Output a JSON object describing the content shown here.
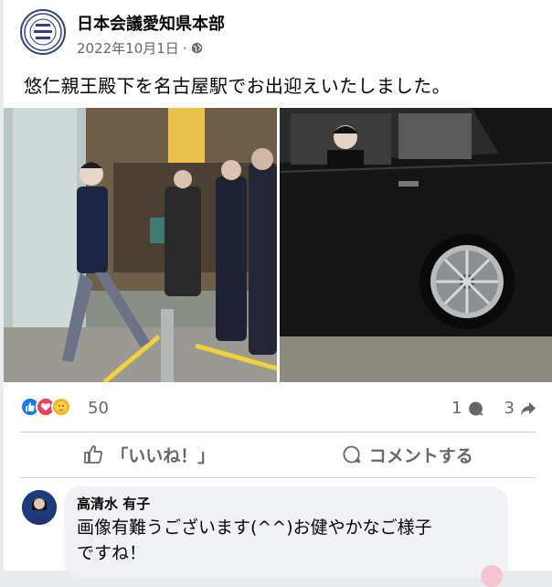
{
  "post": {
    "page_name": "日本会議愛知県本部",
    "date": "2022年10月1日",
    "separator": "·",
    "privacy_icon": "globe-icon",
    "caption": "悠仁親王殿下を名古屋駅でお出迎えいたしました。"
  },
  "reactions": {
    "icons": [
      "like-icon",
      "love-icon",
      "care-icon"
    ],
    "count": "50",
    "comments_count": "1",
    "shares_count": "3"
  },
  "actions": {
    "like_label": "「いいね！」",
    "comment_label": "コメントする"
  },
  "comment": {
    "author": "高清水 有子",
    "text_line1": "画像有難うございます(^^)お健やかなご様子",
    "text_line2": "ですね！"
  },
  "colors": {
    "like_blue": "#1877f2",
    "love_red": "#f33e58",
    "care_yellow": "#f7b125",
    "secondary_text": "#65676b"
  }
}
